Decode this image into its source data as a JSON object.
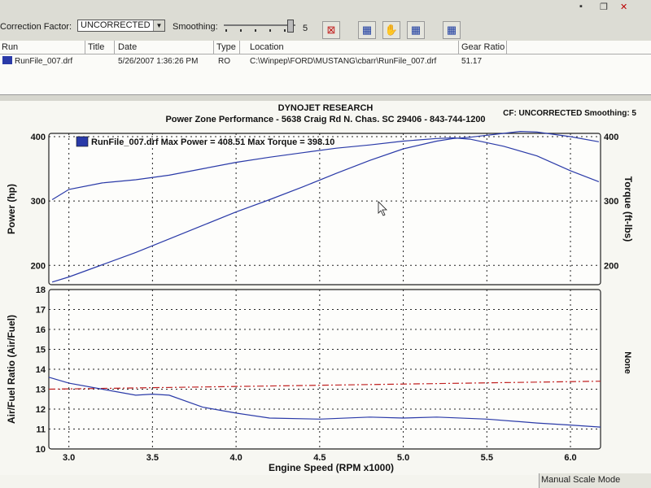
{
  "toolbar": {
    "correction_label": "Correction Factor:",
    "correction_value": "UNCORRECTED",
    "smoothing_label": "Smoothing:",
    "smoothing_value": "5"
  },
  "runs_table": {
    "headers": [
      "Run",
      "Title",
      "Date",
      "Type",
      "Location",
      "Gear Ratio"
    ],
    "rows": [
      {
        "run": "RunFile_007.drf",
        "title": "",
        "date": "5/26/2007 1:36:26 PM",
        "type": "RO",
        "location": "C:\\Winpep\\FORD\\MUSTANG\\cbarr\\RunFile_007.drf",
        "gear_ratio": "51.17"
      }
    ]
  },
  "status_bar": {
    "mode": "Manual Scale Mode"
  },
  "colors": {
    "series": "#2a3aa8",
    "reference": "#c02020"
  },
  "chart_data": [
    {
      "type": "line",
      "header_title": "DYNOJET RESEARCH",
      "header_subtitle": "Power Zone Performance - 5638 Craig Rd N. Chas. SC 29406 - 843-744-1200",
      "header_right": "CF: UNCORRECTED  Smoothing: 5",
      "legend": "RunFile_007.drf Max Power = 408.51 Max Torque = 398.10",
      "ylabel": "Power (hp)",
      "y2label": "Torque (ft-lbs)",
      "ylim": [
        170,
        405
      ],
      "y2lim": [
        170,
        405
      ],
      "yticks": [
        200,
        300,
        400
      ],
      "y2ticks": [
        200,
        300,
        400
      ],
      "xlim": [
        2.88,
        6.18
      ],
      "grid": true,
      "series": [
        {
          "name": "Power",
          "x": [
            2.9,
            3.0,
            3.2,
            3.4,
            3.6,
            3.8,
            4.0,
            4.2,
            4.4,
            4.6,
            4.8,
            5.0,
            5.2,
            5.3,
            5.4,
            5.6,
            5.7,
            5.8,
            6.0,
            6.17
          ],
          "y": [
            174,
            182,
            201,
            220,
            241,
            262,
            283,
            302,
            322,
            343,
            363,
            381,
            393,
            397,
            399,
            405,
            408,
            407,
            400,
            392
          ]
        },
        {
          "name": "Torque",
          "x": [
            2.9,
            3.0,
            3.2,
            3.4,
            3.6,
            3.8,
            4.0,
            4.2,
            4.4,
            4.6,
            4.8,
            5.0,
            5.2,
            5.3,
            5.4,
            5.6,
            5.8,
            6.0,
            6.17
          ],
          "y": [
            302,
            318,
            328,
            333,
            340,
            350,
            360,
            368,
            375,
            382,
            387,
            393,
            397,
            398,
            396,
            385,
            370,
            347,
            330
          ]
        }
      ]
    },
    {
      "type": "line",
      "ylabel": "Air/Fuel Ratio (Air/Fuel)",
      "y2label": "None",
      "xlabel": "Engine Speed (RPM x1000)",
      "xticks": [
        3.0,
        3.5,
        4.0,
        4.5,
        5.0,
        5.5,
        6.0
      ],
      "xlim": [
        2.88,
        6.18
      ],
      "ylim": [
        10,
        18
      ],
      "yticks": [
        10,
        11,
        12,
        13,
        14,
        15,
        16,
        17,
        18
      ],
      "grid": true,
      "series": [
        {
          "x": [
            2.88,
            3.0,
            3.2,
            3.4,
            3.5,
            3.6,
            3.8,
            4.0,
            4.2,
            4.5,
            4.8,
            5.0,
            5.2,
            5.5,
            5.8,
            6.0,
            6.18
          ],
          "y": [
            13.6,
            13.3,
            13.0,
            12.7,
            12.75,
            12.7,
            12.1,
            11.8,
            11.55,
            11.5,
            11.6,
            11.55,
            11.6,
            11.5,
            11.3,
            11.2,
            11.1
          ]
        },
        {
          "x": [
            2.88,
            6.18
          ],
          "y": [
            13.0,
            13.4
          ]
        }
      ]
    }
  ]
}
